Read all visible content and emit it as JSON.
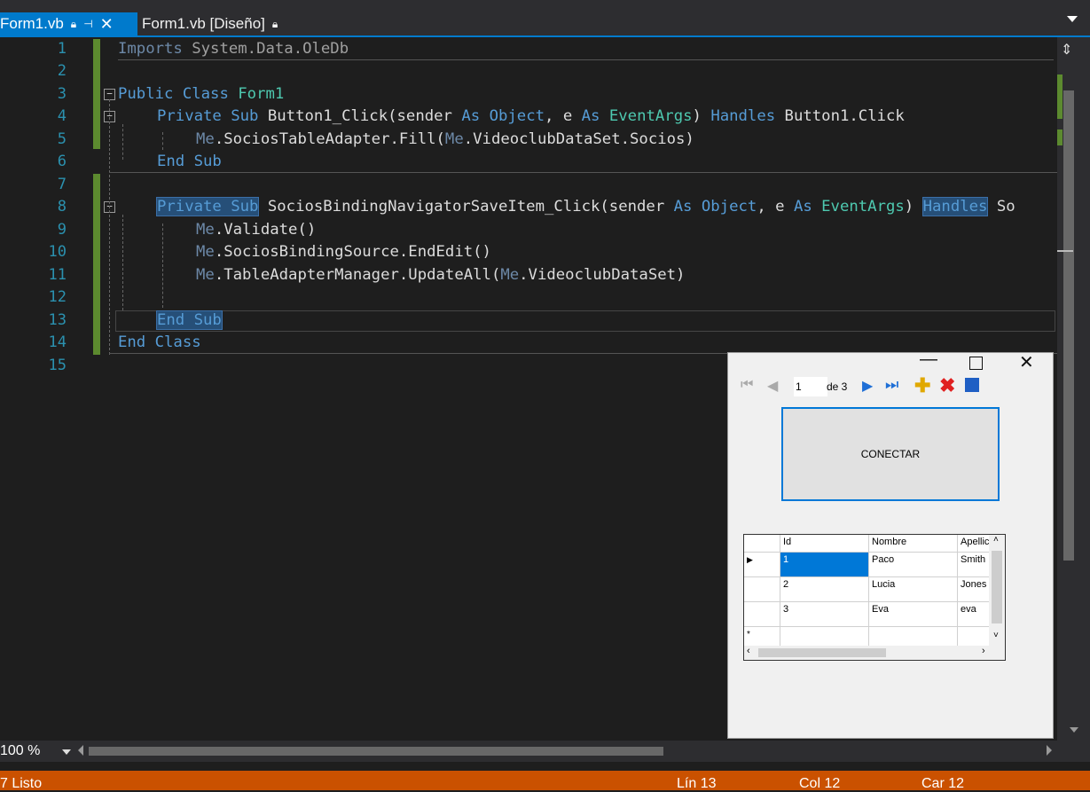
{
  "tabs": [
    {
      "label": "Form1.vb",
      "active": true
    },
    {
      "label": "Form1.vb [Diseño]",
      "active": false
    }
  ],
  "line_numbers": [
    "1",
    "2",
    "3",
    "4",
    "5",
    "6",
    "7",
    "8",
    "9",
    "10",
    "11",
    "12",
    "13",
    "14",
    "15"
  ],
  "code": {
    "l1_a": "Imports",
    "l1_b": " System.Data.OleDb",
    "l3_a": "Public Class",
    "l3_b": "Form1",
    "l4_a": "Private Sub",
    "l4_b": " Button1_Click(sender ",
    "l4_c": "As",
    "l4_d": "Object",
    "l4_e": ", e ",
    "l4_f": "As",
    "l4_g": "EventArgs",
    "l4_h": ") ",
    "l4_i": "Handles",
    "l4_j": " Button1.Click",
    "l5_a": "Me",
    "l5_b": ".SociosTableAdapter.Fill(",
    "l5_c": "Me",
    "l5_d": ".VideoclubDataSet.Socios)",
    "l6": "End Sub",
    "l8_a": "Private Sub",
    "l8_b": " SociosBindingNavigatorSaveItem_Click(sender ",
    "l8_c": "As",
    "l8_d": "Object",
    "l8_e": ", e ",
    "l8_f": "As",
    "l8_g": "EventArgs",
    "l8_h": ") ",
    "l8_i": "Handles",
    "l8_j": " So",
    "l9_a": "Me",
    "l9_b": ".Validate()",
    "l10_a": "Me",
    "l10_b": ".SociosBindingSource.EndEdit()",
    "l11_a": "Me",
    "l11_b": ".TableAdapterManager.UpdateAll(",
    "l11_c": "Me",
    "l11_d": ".VideoclubDataSet)",
    "l13": "End Sub",
    "l14": "End Class"
  },
  "zoom": "100 %",
  "status": {
    "left": "7  Listo",
    "line": "Lín 13",
    "col": "Col 12",
    "car": "Car 12"
  },
  "form": {
    "nav": {
      "position": "1",
      "of": "de 3"
    },
    "connect_label": "CONECTAR",
    "grid": {
      "columns": [
        "Id",
        "Nombre",
        "Apellic"
      ],
      "rows": [
        [
          "1",
          "Paco",
          "Smith"
        ],
        [
          "2",
          "Lucia",
          "Jones"
        ],
        [
          "3",
          "Eva",
          "eva"
        ]
      ]
    }
  },
  "colors": {
    "accent": "#007acc",
    "status_bar": "#ca5100",
    "keyword": "#569cd6",
    "type": "#4ec9b0"
  }
}
